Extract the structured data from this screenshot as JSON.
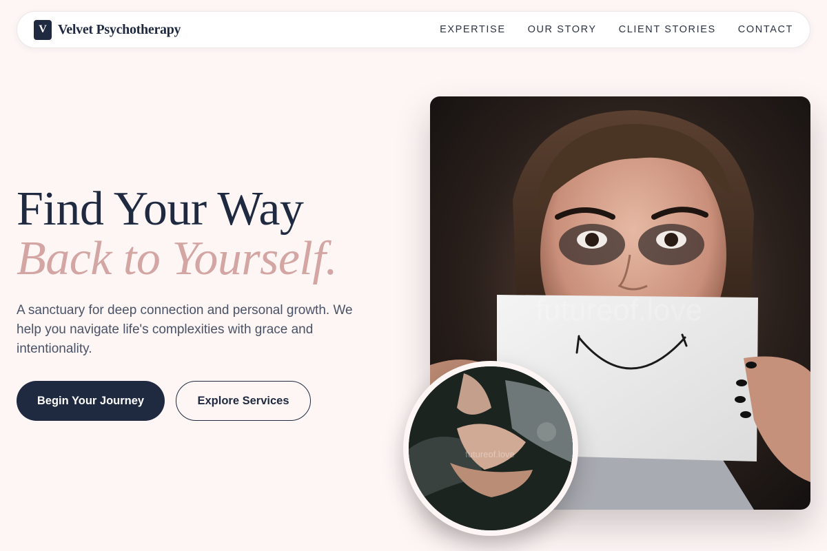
{
  "nav": {
    "brand_mark": "V",
    "brand_name": "Velvet Psychotherapy",
    "links": [
      "EXPERTISE",
      "OUR STORY",
      "CLIENT STORIES",
      "CONTACT"
    ]
  },
  "hero": {
    "title_line1": "Find Your Way",
    "title_line2": "Back to Yourself.",
    "description": "A sanctuary for deep connection and personal growth. We help you navigate life's complexities with grace and intentionality.",
    "primary_button": "Begin Your Journey",
    "secondary_button": "Explore Services"
  },
  "images": {
    "main_watermark": "futureof.love",
    "inset_watermark": "futureof.love"
  },
  "colors": {
    "page_background": "#fdf6f5",
    "navy": "#1f2940",
    "accent_rose": "#d3a5a3",
    "body_text": "#4a5266"
  }
}
